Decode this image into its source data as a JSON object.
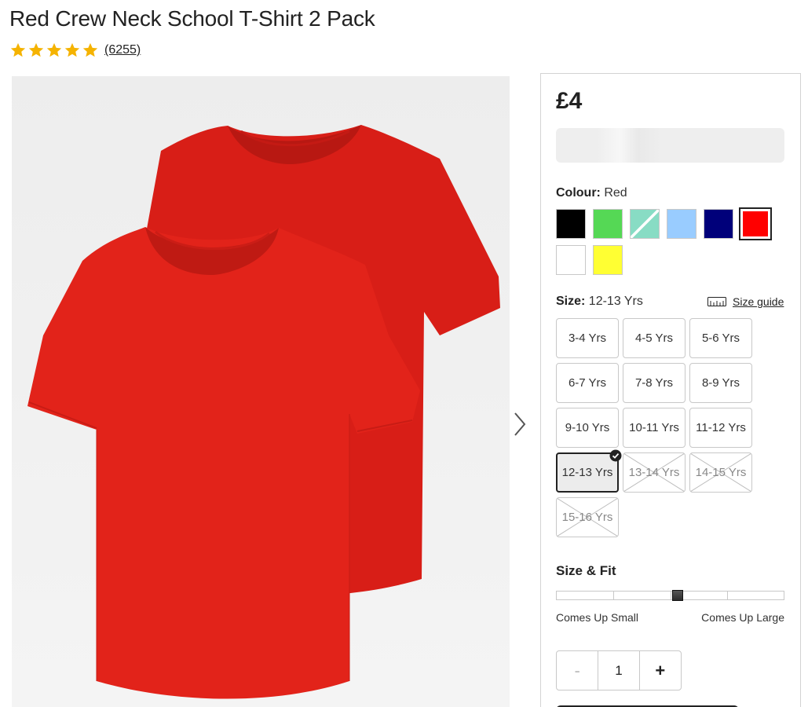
{
  "product": {
    "title": "Red Crew Neck School T-Shirt 2 Pack",
    "rating_stars": 5,
    "review_count": "(6255)",
    "price": "£4"
  },
  "colour": {
    "label": "Colour:",
    "value": "Red",
    "swatches": [
      {
        "name": "black",
        "color": "#000000"
      },
      {
        "name": "green",
        "color": "#55d855"
      },
      {
        "name": "mint-green",
        "color": "#88dcc4"
      },
      {
        "name": "light-blue",
        "color": "#99ccff"
      },
      {
        "name": "navy",
        "color": "#00007a"
      },
      {
        "name": "red",
        "color": "#ff0000",
        "selected": true
      },
      {
        "name": "white",
        "color": "#ffffff"
      },
      {
        "name": "yellow",
        "color": "#ffff33"
      }
    ]
  },
  "size": {
    "label": "Size:",
    "value": "12-13 Yrs",
    "guide_label": "Size guide",
    "options": [
      {
        "label": "3-4 Yrs",
        "state": "available"
      },
      {
        "label": "4-5 Yrs",
        "state": "available"
      },
      {
        "label": "5-6 Yrs",
        "state": "available"
      },
      {
        "label": "6-7 Yrs",
        "state": "available"
      },
      {
        "label": "7-8 Yrs",
        "state": "available"
      },
      {
        "label": "8-9 Yrs",
        "state": "available"
      },
      {
        "label": "9-10 Yrs",
        "state": "available"
      },
      {
        "label": "10-11 Yrs",
        "state": "available"
      },
      {
        "label": "11-12 Yrs",
        "state": "available"
      },
      {
        "label": "12-13 Yrs",
        "state": "selected"
      },
      {
        "label": "13-14 Yrs",
        "state": "unavailable"
      },
      {
        "label": "14-15 Yrs",
        "state": "unavailable"
      },
      {
        "label": "15-16 Yrs",
        "state": "unavailable"
      }
    ]
  },
  "fit": {
    "label": "Size & Fit",
    "min_label": "Comes Up Small",
    "max_label": "Comes Up Large",
    "value_fraction": 0.5
  },
  "quantity": {
    "minus": "-",
    "value": "1",
    "plus": "+"
  },
  "colors": {
    "star": "#f5b301",
    "shirt": "#e2231a"
  }
}
